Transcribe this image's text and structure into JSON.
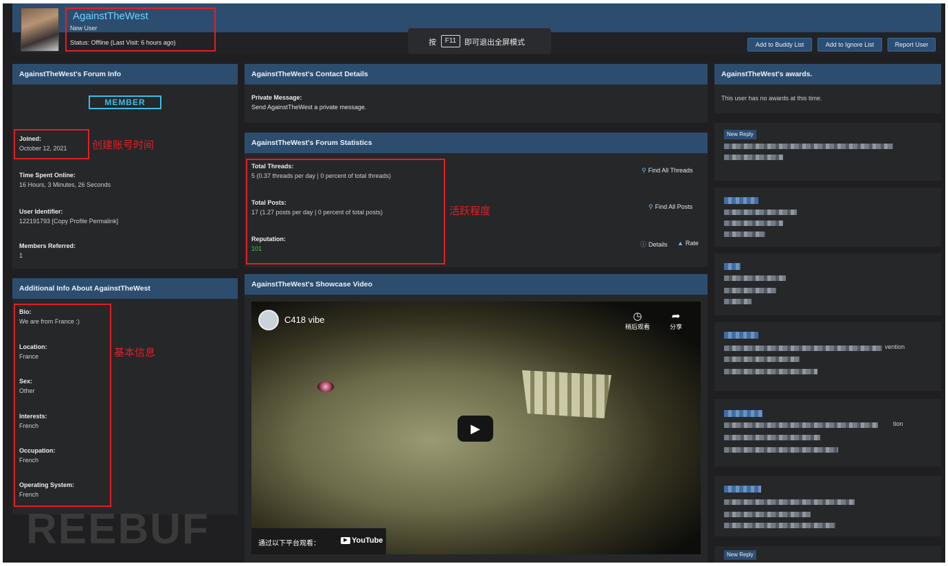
{
  "header": {
    "username": "AgainstTheWest",
    "user_title": "New User",
    "status": "Status: Offline (Last Visit: 6 hours ago)",
    "f11_hint": {
      "before": "按",
      "key": "F11",
      "after": "即可退出全屏模式"
    },
    "buttons": {
      "buddy": "Add to Buddy List",
      "ignore": "Add to Ignore List",
      "report": "Report User"
    }
  },
  "forum_info": {
    "title": "AgainstTheWest's Forum Info",
    "badge": "MEMBER",
    "joined_label": "Joined:",
    "joined_value": "October 12, 2021",
    "joined_note": "创建账号时间",
    "online_label": "Time Spent Online:",
    "online_value": "16 Hours, 3 Minutes, 26 Seconds",
    "uid_label": "User Identifier:",
    "uid_value": "122191793 [Copy Profile Permalink]",
    "referred_label": "Members Referred:",
    "referred_value": "1"
  },
  "additional_info": {
    "title": "Additional Info About AgainstTheWest",
    "note": "基本信息",
    "fields": [
      {
        "label": "Bio:",
        "value": "We are from France :)"
      },
      {
        "label": "Location:",
        "value": "France"
      },
      {
        "label": "Sex:",
        "value": "Other"
      },
      {
        "label": "Interests:",
        "value": "French"
      },
      {
        "label": "Occupation:",
        "value": "French"
      },
      {
        "label": "Operating System:",
        "value": "French"
      }
    ]
  },
  "contact": {
    "title": "AgainstTheWest's Contact Details",
    "pm_label": "Private Message:",
    "pm_value": "Send AgainstTheWest a private message."
  },
  "stats": {
    "title": "AgainstTheWest's Forum Statistics",
    "note": "活跃程度",
    "threads_label": "Total Threads:",
    "threads_value": "5 (0.37 threads per day | 0 percent of total threads)",
    "threads_link": "Find All Threads",
    "posts_label": "Total Posts:",
    "posts_value": "17 (1.27 posts per day | 0 percent of total posts)",
    "posts_link": "Find All Posts",
    "rep_label": "Reputation:",
    "rep_value": "101",
    "details_link": "Details",
    "rate_link": "Rate"
  },
  "video": {
    "title": "AgainstTheWest's Showcase Video",
    "channel": "C418 vibe",
    "watch_later": "稍后观看",
    "share": "分享",
    "watch_on": "通过以下平台观看：",
    "platform": "YouTube"
  },
  "awards": {
    "title": "AgainstTheWest's awards.",
    "empty": "This user has no awards at this time."
  },
  "feed": {
    "new_reply": "New Reply",
    "frag1": "vention",
    "frag2": "tion"
  },
  "watermark": "REEBUF",
  "colors": {
    "header_blue": "#2d4d6f",
    "link_cyan": "#6fd1ff",
    "annotation_red": "#e21f26",
    "reputation_green": "#3ed13e"
  }
}
